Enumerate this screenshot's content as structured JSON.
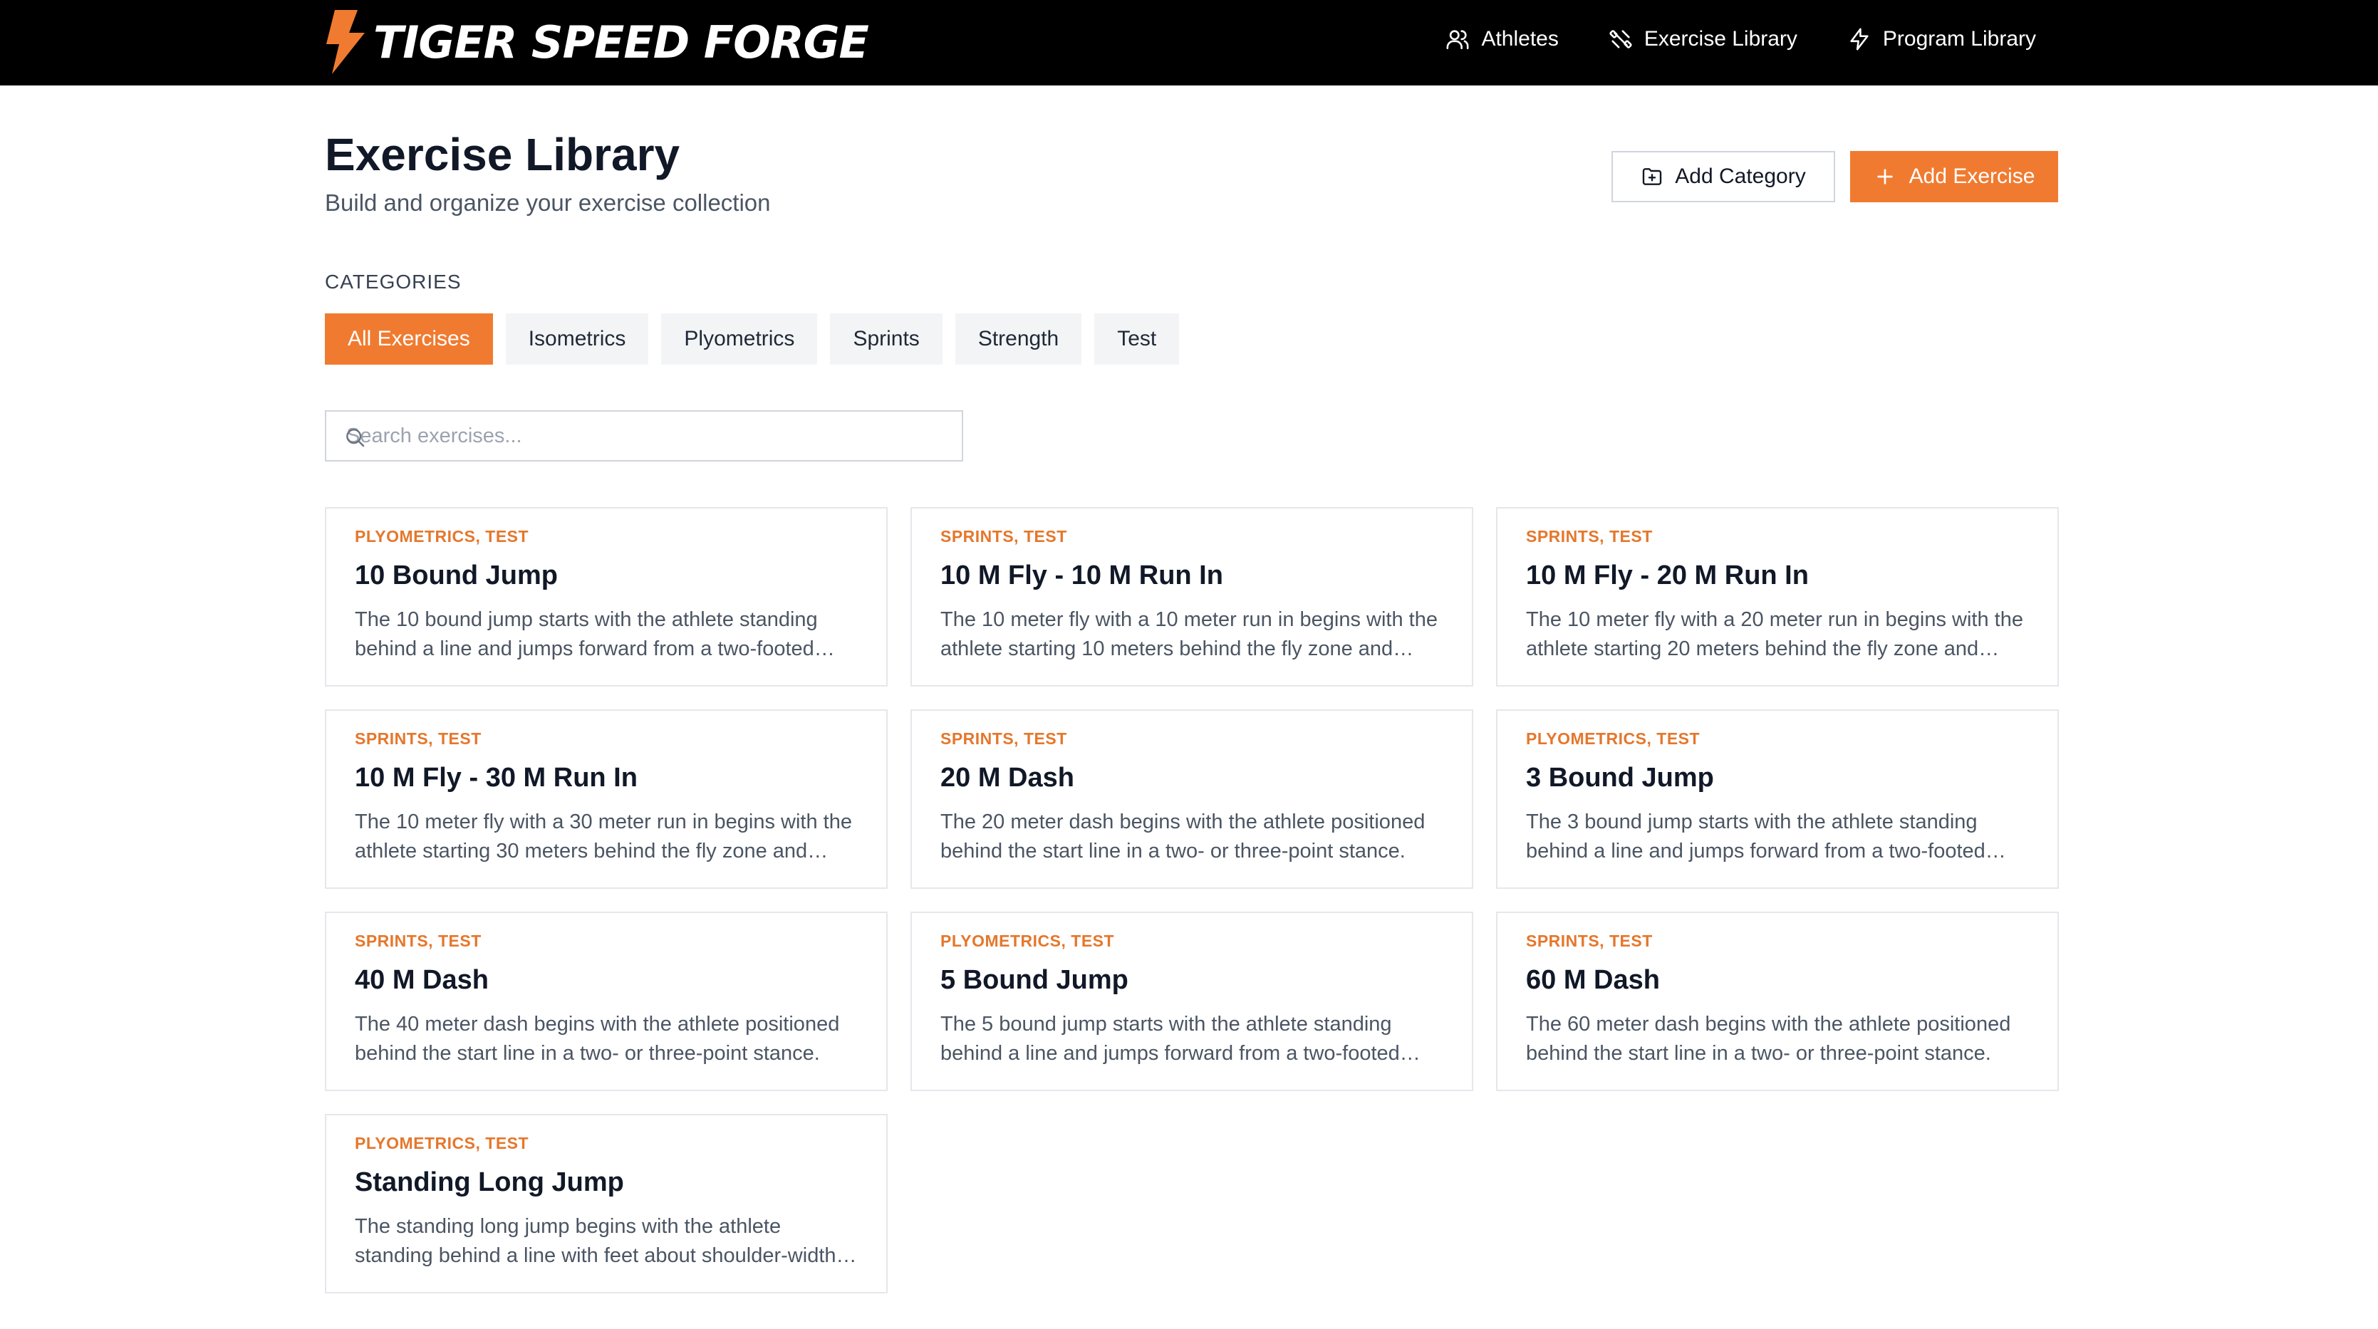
{
  "brand": {
    "name": "TIGER SPEED FORGE",
    "accent": "#f07b30"
  },
  "nav": {
    "items": [
      {
        "label": "Athletes",
        "icon": "users-icon"
      },
      {
        "label": "Exercise Library",
        "icon": "exercise-icon"
      },
      {
        "label": "Program Library",
        "icon": "lightning-icon"
      }
    ]
  },
  "header": {
    "title": "Exercise Library",
    "subtitle": "Build and organize your exercise collection",
    "add_category_label": "Add Category",
    "add_exercise_label": "Add Exercise"
  },
  "categories": {
    "heading": "CATEGORIES",
    "items": [
      "All Exercises",
      "Isometrics",
      "Plyometrics",
      "Sprints",
      "Strength",
      "Test"
    ],
    "active": "All Exercises"
  },
  "search": {
    "placeholder": "Search exercises...",
    "value": ""
  },
  "exercises": [
    {
      "categories": "PLYOMETRICS, TEST",
      "title": "10 Bound Jump",
      "description": "The 10 bound jump starts with the athlete standing behind a line and jumps forward from a two-footed stance."
    },
    {
      "categories": "SPRINTS, TEST",
      "title": "10 M Fly - 10 M Run In",
      "description": "The 10 meter fly with a 10 meter run in begins with the athlete starting 10 meters behind the fly zone and accelerating."
    },
    {
      "categories": "SPRINTS, TEST",
      "title": "10 M Fly - 20 M Run In",
      "description": "The 10 meter fly with a 20 meter run in begins with the athlete starting 20 meters behind the fly zone and accelerating."
    },
    {
      "categories": "SPRINTS, TEST",
      "title": "10 M Fly - 30 M Run In",
      "description": "The 10 meter fly with a 30 meter run in begins with the athlete starting 30 meters behind the fly zone and accelerating."
    },
    {
      "categories": "SPRINTS, TEST",
      "title": "20 M Dash",
      "description": "The 20 meter dash begins with the athlete positioned behind the start line in a two- or three-point stance."
    },
    {
      "categories": "PLYOMETRICS, TEST",
      "title": "3 Bound Jump",
      "description": "The 3 bound jump starts with the athlete standing behind a line and jumps forward from a two-footed stance."
    },
    {
      "categories": "SPRINTS, TEST",
      "title": "40 M Dash",
      "description": "The 40 meter dash begins with the athlete positioned behind the start line in a two- or three-point stance."
    },
    {
      "categories": "PLYOMETRICS, TEST",
      "title": "5 Bound Jump",
      "description": "The 5 bound jump starts with the athlete standing behind a line and jumps forward from a two-footed stance."
    },
    {
      "categories": "SPRINTS, TEST",
      "title": "60 M Dash",
      "description": "The 60 meter dash begins with the athlete positioned behind the start line in a two- or three-point stance."
    },
    {
      "categories": "PLYOMETRICS, TEST",
      "title": "Standing Long Jump",
      "description": "The standing long jump begins with the athlete standing behind a line with feet about shoulder-width apart."
    }
  ]
}
